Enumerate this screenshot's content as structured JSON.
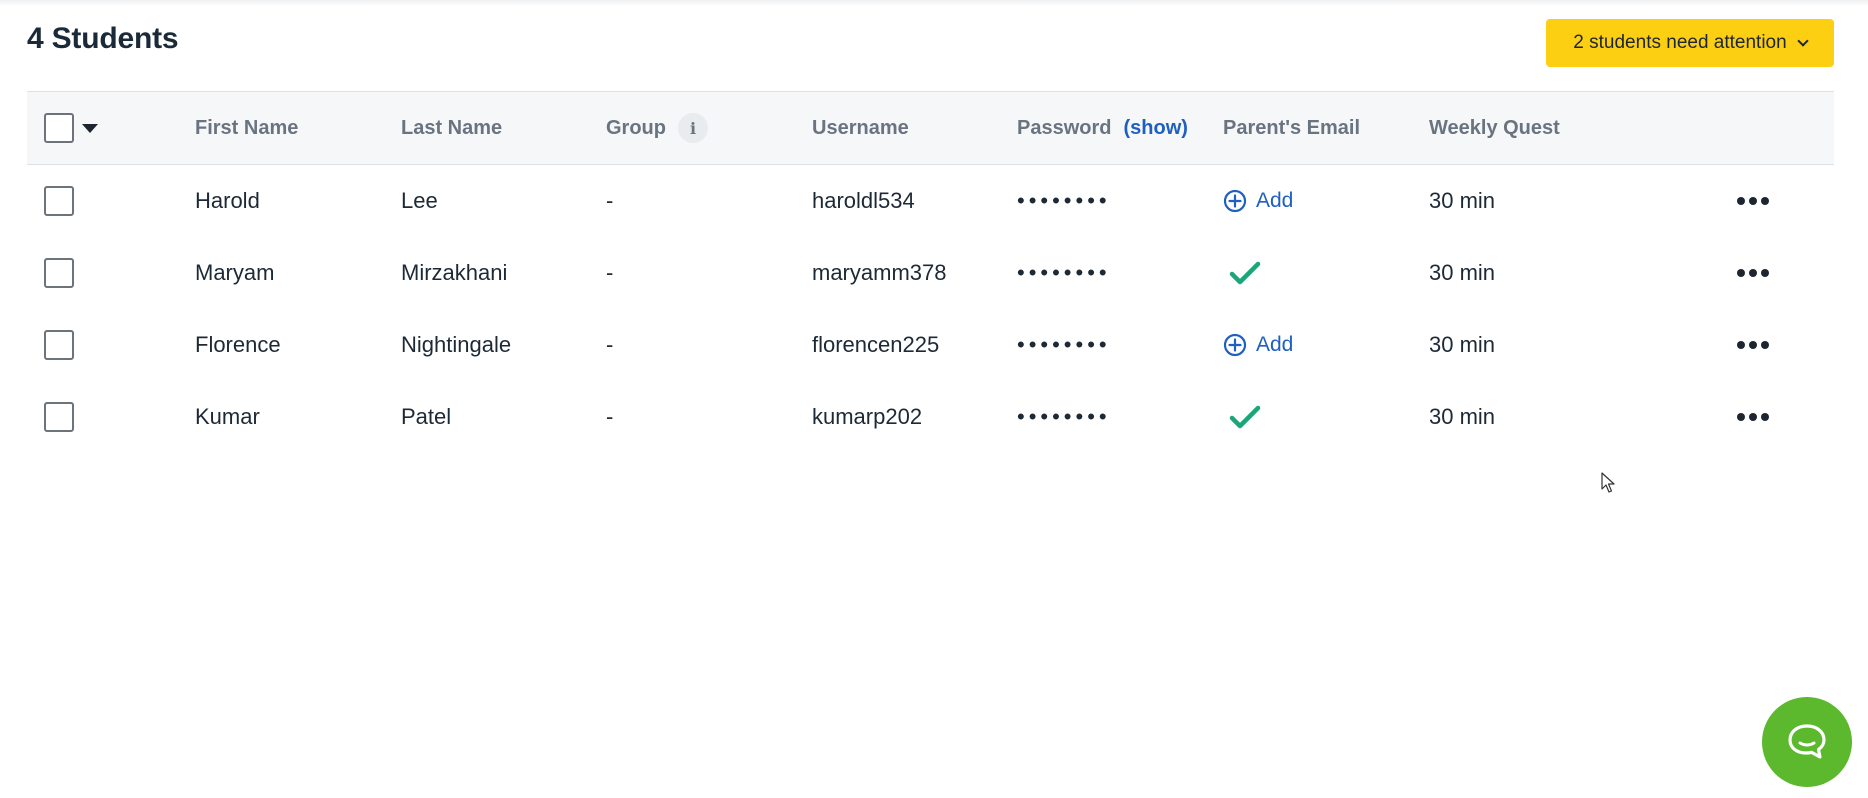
{
  "header": {
    "title": "4 Students",
    "attention_button": "2 students need attention"
  },
  "table": {
    "columns": {
      "first_name": "First Name",
      "last_name": "Last Name",
      "group": "Group",
      "username": "Username",
      "password": "Password",
      "password_show": "(show)",
      "parent_email": "Parent's Email",
      "weekly_quest": "Weekly Quest"
    },
    "rows": [
      {
        "first": "Harold",
        "last": "Lee",
        "group": "-",
        "username": "haroldl534",
        "password": "••••••••",
        "email_status": "add",
        "email_add_label": "Add",
        "weekly": "30 min"
      },
      {
        "first": "Maryam",
        "last": "Mirzakhani",
        "group": "-",
        "username": "maryamm378",
        "password": "••••••••",
        "email_status": "verified",
        "weekly": "30 min"
      },
      {
        "first": "Florence",
        "last": "Nightingale",
        "group": "-",
        "username": "florencen225",
        "password": "••••••••",
        "email_status": "add",
        "email_add_label": "Add",
        "weekly": "30 min"
      },
      {
        "first": "Kumar",
        "last": "Patel",
        "group": "-",
        "username": "kumarp202",
        "password": "••••••••",
        "email_status": "verified",
        "weekly": "30 min"
      }
    ]
  },
  "colors": {
    "accent_yellow": "#fccf13",
    "link_blue": "#1f5fc0",
    "check_green": "#1ba67a",
    "chat_green": "#5cb82d"
  },
  "icons": {
    "info": "info-icon",
    "add": "plus-circle-icon",
    "verified": "checkmark-icon",
    "more": "more-horizontal-icon",
    "chat": "chat-bubble-icon",
    "chevron": "chevron-down-icon",
    "caret": "caret-down-icon"
  }
}
